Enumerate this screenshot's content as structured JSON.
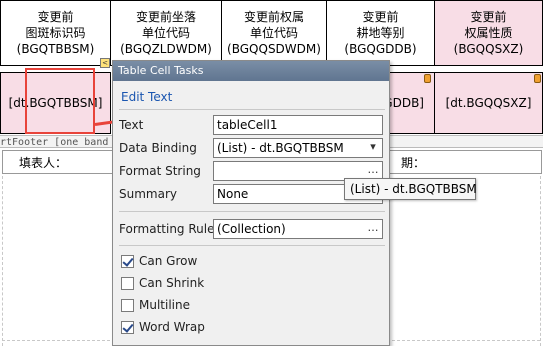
{
  "table": {
    "headers": [
      {
        "line1": "变更前",
        "line2": "图斑标识码",
        "line3": "(BGQTBBSM)"
      },
      {
        "line1": "变更前坐落",
        "line2": "单位代码",
        "line3": "(BGQZLDWDM)"
      },
      {
        "line1": "变更前权属",
        "line2": "单位代码",
        "line3": "(BGQQSDWDM)"
      },
      {
        "line1": "变更前",
        "line2": "耕地等别",
        "line3": "(BGQGDDB)"
      },
      {
        "line1": "变更前",
        "line2": "权属性质",
        "line3": "(BGQQSXZ)"
      }
    ],
    "data_cells": [
      "[dt.BGQTBBSM]",
      "GDDB]",
      "[dt.BGQQSXZ]"
    ]
  },
  "band": {
    "label": "rtFooter [one band"
  },
  "footer": {
    "filler_label": "填表人：",
    "date_label": "期："
  },
  "panel": {
    "title": "Table Cell Tasks",
    "edit_text_link": "Edit Text",
    "rows": {
      "text_label": "Text",
      "text_value": "tableCell1",
      "data_binding_label": "Data Binding",
      "data_binding_value": "(List) - dt.BGQTBBSM",
      "format_string_label": "Format String",
      "format_string_value": "",
      "summary_label": "Summary",
      "summary_value": "None",
      "formatting_rules_label": "Formatting Rules",
      "formatting_rules_value": "(Collection)"
    },
    "checkboxes": [
      {
        "label": "Can Grow",
        "checked": true
      },
      {
        "label": "Can Shrink",
        "checked": false
      },
      {
        "label": "Multiline",
        "checked": false
      },
      {
        "label": "Word Wrap",
        "checked": true
      }
    ],
    "ellipsis": "…",
    "dropdown_arrow": "▾"
  },
  "tooltip": {
    "text": "(List) - dt.BGQTBBSM"
  },
  "smart_tag_glyph": "<",
  "colors": {
    "header_pink": "#f8dde6",
    "accent_red": "#e8433a",
    "link_blue": "#1a56b0"
  },
  "icons": [
    "smart-tag-icon",
    "cell-handle-icon",
    "ellipsis-icon",
    "dropdown-arrow-icon",
    "checkbox-icon"
  ]
}
